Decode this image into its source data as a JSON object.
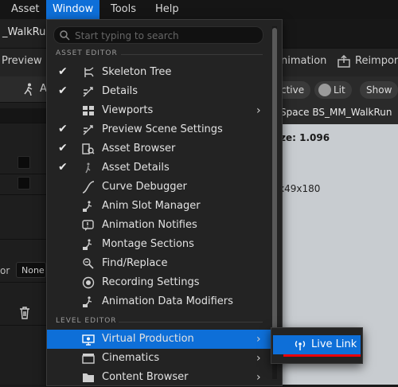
{
  "menubar": {
    "items": [
      "Asset",
      "Window",
      "Tools",
      "Help"
    ]
  },
  "background": {
    "asset_tab": "_WalkRun",
    "toolbar_left": "Preview M",
    "toolbar_anim": "nimation",
    "toolbar_reimport": "Reimport",
    "viewport_pill_active": "ctive",
    "viewport_pill_lit": "Lit",
    "viewport_pill_show": "Show",
    "viewport_space": "Space BS_MM_WalkRun",
    "viewport_size": "ze: 1.096",
    "viewport_dims": "x49x180",
    "left_row_label": "or",
    "left_none": "None",
    "left_a": "A"
  },
  "menu": {
    "search_placeholder": "Start typing to search",
    "sections": {
      "asset_editor": "ASSET EDITOR",
      "level_editor": "LEVEL EDITOR"
    },
    "asset_items": [
      {
        "label": "Skeleton Tree",
        "checked": true,
        "icon": "skeleton-tree-icon"
      },
      {
        "label": "Details",
        "checked": true,
        "icon": "details-icon"
      },
      {
        "label": "Viewports",
        "checked": false,
        "icon": "viewports-icon",
        "submenu": true
      },
      {
        "label": "Preview Scene Settings",
        "checked": true,
        "icon": "preview-scene-icon"
      },
      {
        "label": "Asset Browser",
        "checked": true,
        "icon": "asset-browser-icon"
      },
      {
        "label": "Asset Details",
        "checked": true,
        "icon": "asset-details-icon"
      },
      {
        "label": "Curve Debugger",
        "checked": false,
        "icon": "curve-icon"
      },
      {
        "label": "Anim Slot Manager",
        "checked": false,
        "icon": "slot-manager-icon"
      },
      {
        "label": "Animation Notifies",
        "checked": false,
        "icon": "notifies-icon"
      },
      {
        "label": "Montage Sections",
        "checked": false,
        "icon": "montage-icon"
      },
      {
        "label": "Find/Replace",
        "checked": false,
        "icon": "find-replace-icon"
      },
      {
        "label": "Recording Settings",
        "checked": false,
        "icon": "recording-icon"
      },
      {
        "label": "Animation Data Modifiers",
        "checked": false,
        "icon": "modifiers-icon"
      }
    ],
    "level_items": [
      {
        "label": "Virtual Production",
        "icon": "virtual-production-icon",
        "submenu": true,
        "selected": true
      },
      {
        "label": "Cinematics",
        "icon": "cinematics-icon",
        "submenu": true
      },
      {
        "label": "Content Browser",
        "icon": "content-browser-icon",
        "submenu": true
      }
    ],
    "check_glyph": "✔",
    "submenu_glyph": "›"
  },
  "submenu": {
    "live_link": "Live Link"
  },
  "colors": {
    "accent": "#0e6fd8",
    "underline": "#e8000a"
  }
}
